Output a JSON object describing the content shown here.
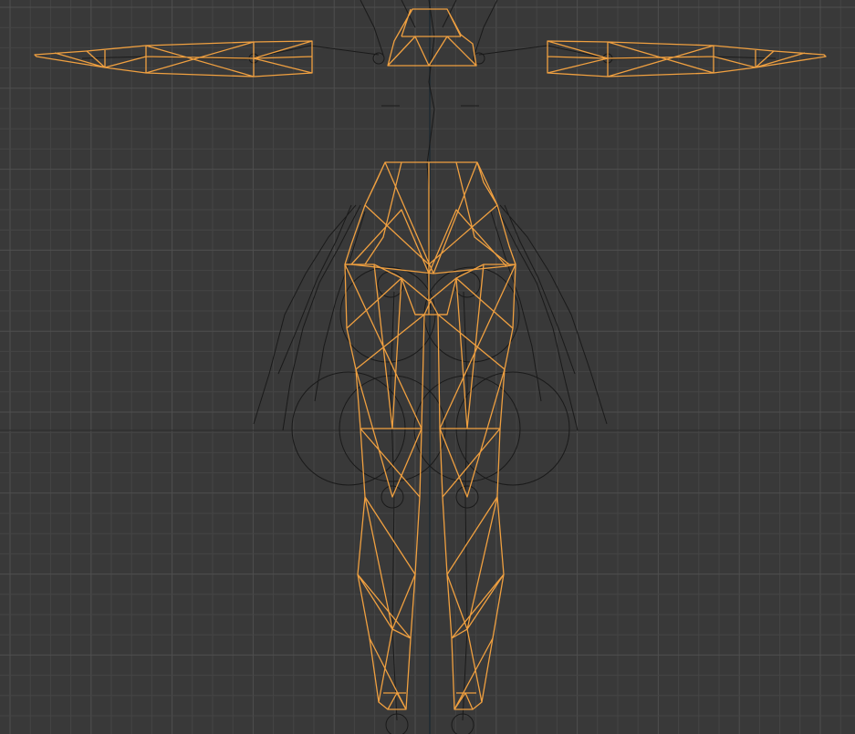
{
  "viewport": {
    "view": "front-orthographic",
    "shading": "wireframe",
    "colors": {
      "background": "#393939",
      "grid_minor": "#454545",
      "grid_major": "#4f4f4f",
      "axis_line": "#1e2a33",
      "selected_mesh": "#f0a040",
      "armature": "#1a1a1a"
    }
  },
  "scene": {
    "objects": [
      {
        "name": "body-mesh",
        "kind": "mesh",
        "state": "selected"
      },
      {
        "name": "armature",
        "kind": "armature",
        "state": "unselected"
      }
    ]
  }
}
